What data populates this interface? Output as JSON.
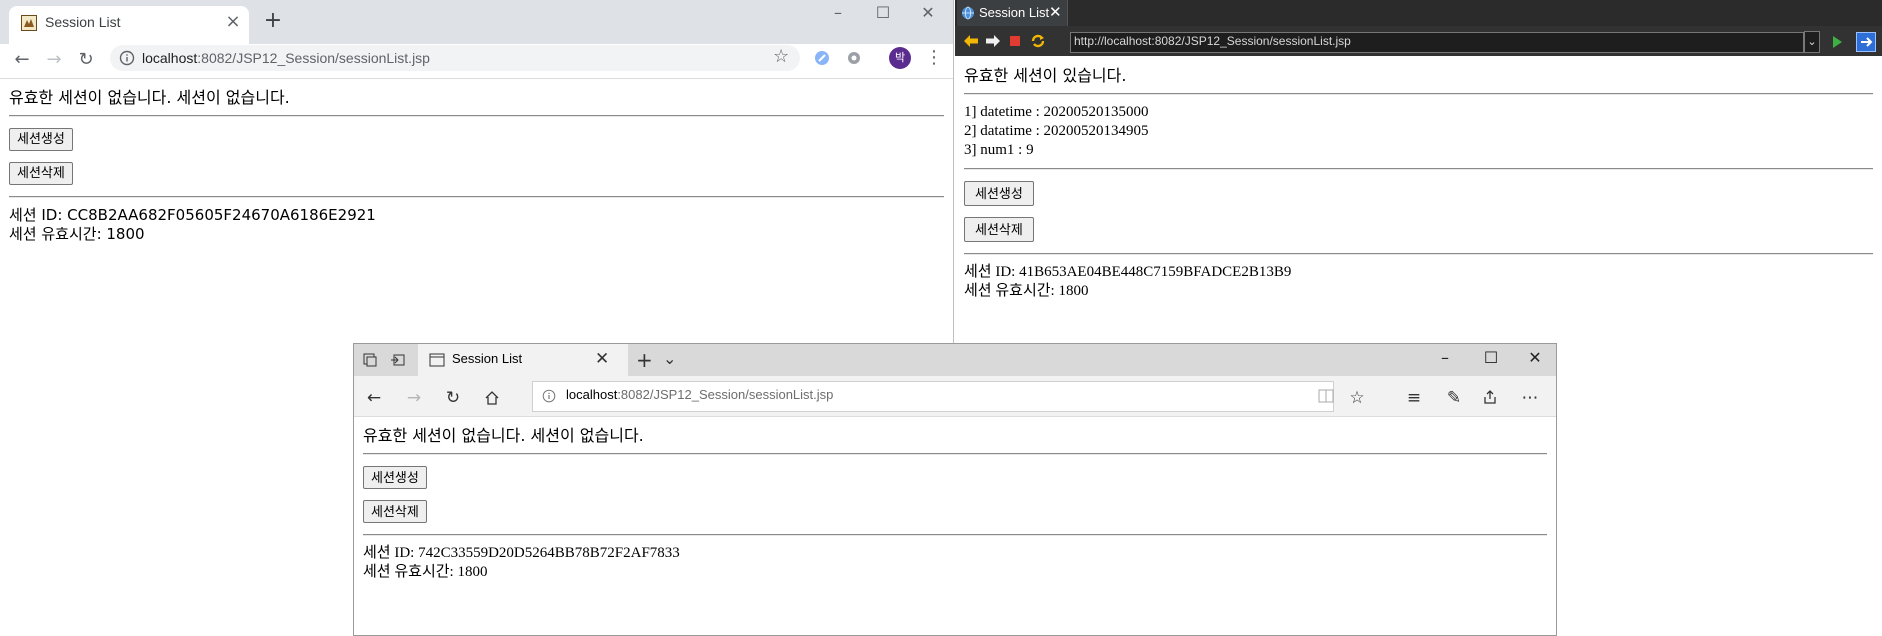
{
  "chrome": {
    "tab_title": "Session List",
    "url_host": "localhost",
    "url_rest": ":8082/JSP12_Session/sessionList.jsp",
    "profile_initial": "박",
    "page": {
      "message": "유효한 세션이 없습니다. 세션이 없습니다.",
      "create_button": "세션생성",
      "delete_button": "세션삭제",
      "session_id": "세션 ID: CC8B2AA682F05605F24670A6186E2921",
      "session_timeout": "세션 유효시간: 1800"
    }
  },
  "eclipse": {
    "tab_title": "Session List",
    "url": "http://localhost:8082/JSP12_Session/sessionList.jsp",
    "page": {
      "message": "유효한 세션이 있습니다.",
      "attributes": [
        "1] datetime : 20200520135000",
        "2] datatime : 20200520134905",
        "3] num1 : 9"
      ],
      "create_button": "세션생성",
      "delete_button": "세션삭제",
      "session_id": "세션 ID: 41B653AE04BE448C7159BFADCE2B13B9",
      "session_timeout": "세션 유효시간: 1800"
    }
  },
  "edge": {
    "tab_title": "Session List",
    "url_host": "localhost",
    "url_rest": ":8082/JSP12_Session/sessionList.jsp",
    "page": {
      "message": "유효한 세션이 없습니다. 세션이 없습니다.",
      "create_button": "세션생성",
      "delete_button": "세션삭제",
      "session_id": "세션 ID: 742C33559D20D5264BB78B72F2AF7833",
      "session_timeout": "세션 유효시간: 1800"
    }
  },
  "icons": {
    "chrome_back": "back-arrow-icon",
    "chrome_forward": "forward-arrow-icon",
    "chrome_reload": "reload-icon",
    "chrome_info": "info-icon",
    "chrome_star": "star-icon",
    "eclipse_globe": "globe-icon",
    "edge_home": "home-icon"
  }
}
